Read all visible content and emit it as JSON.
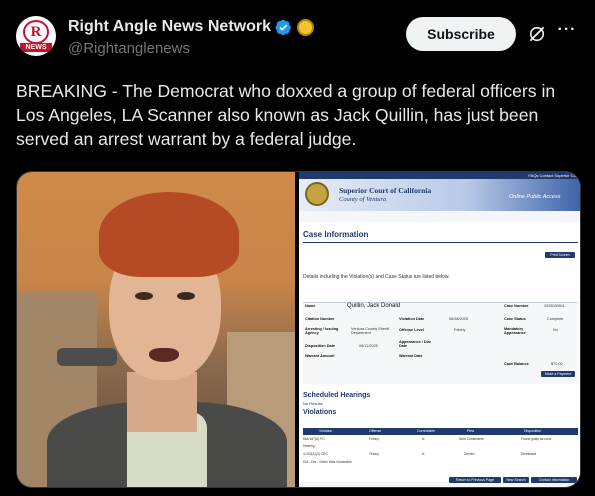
{
  "account": {
    "name": "Right Angle News Network",
    "handle": "@Rightanglenews",
    "avatar_letter": "R",
    "avatar_text": "NEWS",
    "verified_color": "#1d9bf0",
    "affiliate_color": "#f4c430"
  },
  "actions": {
    "subscribe_label": "Subscribe",
    "grok_icon": "grok-icon",
    "more_label": "···"
  },
  "tweet": {
    "text": "BREAKING - The Democrat who doxxed a group of federal officers in Los Angeles, LA Scanner also known as Jack Quillin, has just been served an arrest warrant by a federal judge."
  },
  "document": {
    "top_links": "FAQs   Contact Superior Cou",
    "court_name": "Superior Court of California",
    "county": "County of Ventura",
    "online_access": "Online Public Access",
    "section_title": "Case Information",
    "print_button": "Print Screen",
    "details_text": "Details including the Violation(s) and Case Status are listed below.",
    "defendant_name": "Quillin, Jack Donald",
    "fields_left": [
      "Name",
      "Citation Number",
      "Arresting / Issuing Agency",
      "Disposition Date",
      "Warrant Amount"
    ],
    "fields_mid": [
      "Violation Date",
      "Offense Level",
      "Appearance / Due Date",
      "Warrant Date"
    ],
    "agency": "Ventura County Sheriff Department",
    "disposition_date": "09/11/2025",
    "violation_date": "06/28/2025",
    "offense_level": "Felony",
    "fields_right": [
      "Case Number",
      "Case Status",
      "Mandatory Appearance",
      "Case Balance"
    ],
    "case_number": "2025039911",
    "case_status": "Complete",
    "mandatory_appearance": "No",
    "case_balance": "$70.00",
    "pay_button": "Make a Payment",
    "hearings_title": "Scheduled Hearings",
    "no_results": "No Results",
    "violations_title": "Violations",
    "violation_headers": [
      "Violation",
      "Offense",
      "Correctable",
      "Plea",
      "Disposition"
    ],
    "violation_rows": [
      [
        "664/187(A) PC",
        "Felony",
        "N",
        "Nolo Contendere",
        "Found guilty as conv"
      ],
      [
        "Hearing",
        "",
        "",
        "",
        ""
      ],
      [
        "4-422(A)(3) CRC",
        "Felony",
        "N",
        "Denied",
        "Dismissed"
      ],
      [
        "D/A - Dis - Victim Was Vulnerable",
        "",
        "",
        "",
        ""
      ]
    ],
    "bottom_buttons": [
      "Return to Previous Page",
      "New Search",
      "Contact Information"
    ]
  }
}
